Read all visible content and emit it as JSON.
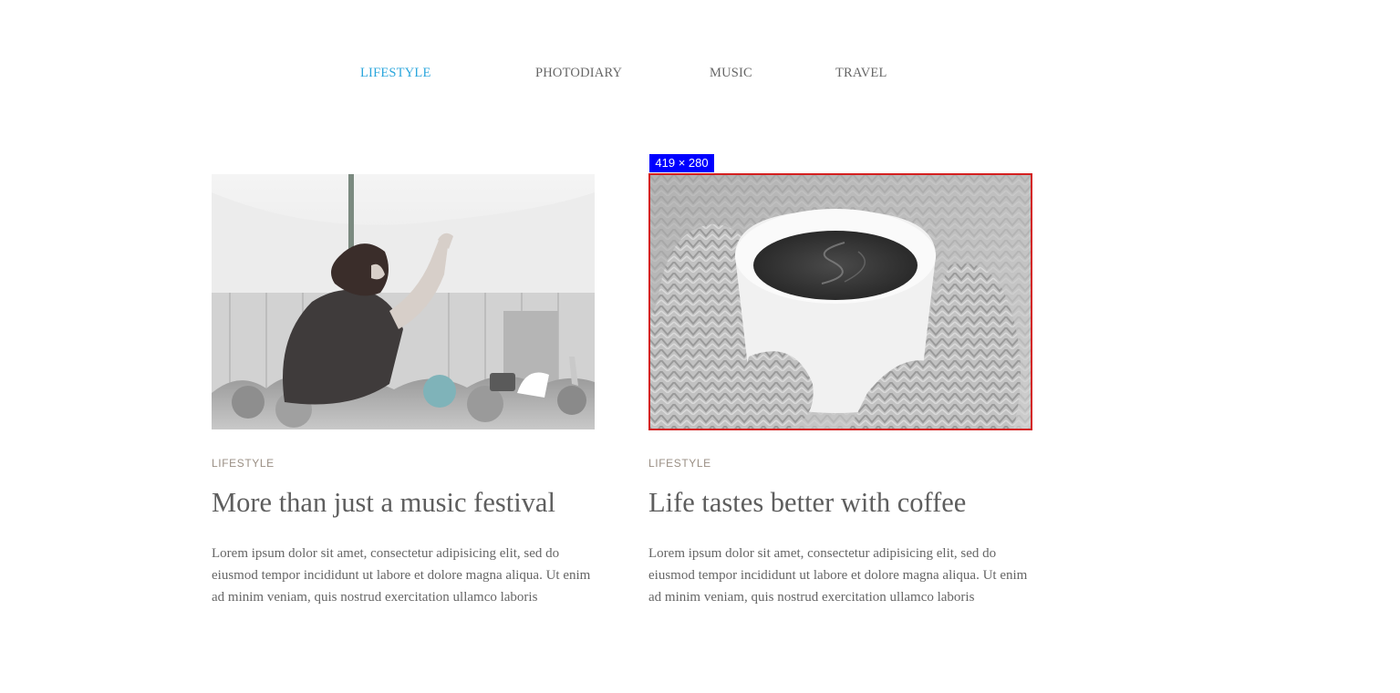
{
  "nav": {
    "items": [
      {
        "label": "LIFESTYLE",
        "active": true
      },
      {
        "label": "PHOTODIARY",
        "active": false
      },
      {
        "label": "MUSIC",
        "active": false
      },
      {
        "label": "TRAVEL",
        "active": false
      }
    ],
    "active_color": "#2aa6dc"
  },
  "posts": [
    {
      "image": "festival-crowd-photo",
      "category": "LIFESTYLE",
      "title": "More than just a music festival",
      "excerpt": "Lorem ipsum dolor sit amet, consectetur adipisicing elit, sed do eiusmod tempor incididunt ut labore et dolore magna aliqua. Ut enim ad minim veniam, quis nostrud exercitation ullamco laboris"
    },
    {
      "image": "coffee-mittens-photo",
      "category": "LIFESTYLE",
      "title": "Life tastes better with coffee",
      "excerpt": "Lorem ipsum dolor sit amet, consectetur adipisicing elit, sed do eiusmod tempor incididunt ut labore et dolore magna aliqua. Ut enim ad minim veniam, quis nostrud exercitation ullamco laboris"
    }
  ],
  "overlay": {
    "dimension_label": "419 × 280",
    "label_color": "#0000ff",
    "outline_color": "#d42020"
  }
}
